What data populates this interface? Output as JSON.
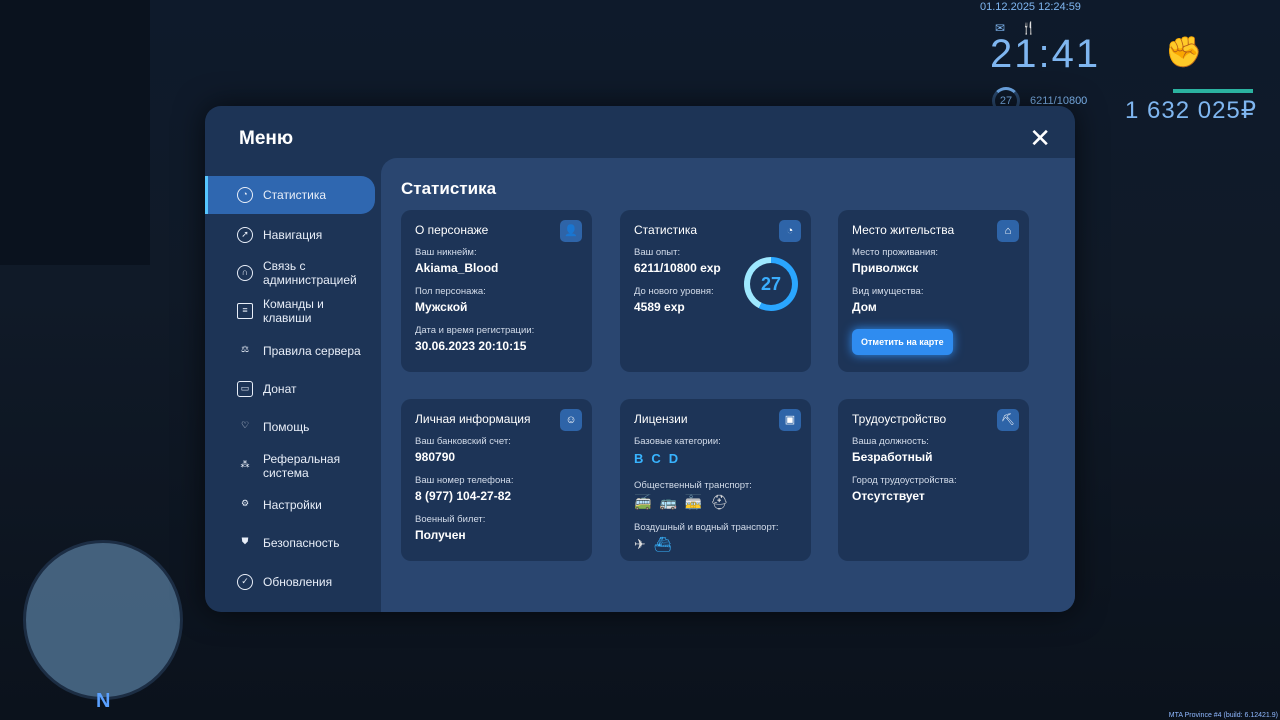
{
  "hud": {
    "date": "01.12.2025 12:24:59",
    "clock": "21:41",
    "level": "27",
    "exp": "6211/10800",
    "money": "1 632 025₽",
    "build": "MTA Province #4 (build: 6.12421.9)",
    "map_north": "N"
  },
  "menu": {
    "title": "Меню",
    "content_title": "Статистика",
    "sidebar": [
      {
        "label": "Статистика",
        "icon": "pie-chart-icon",
        "active": true
      },
      {
        "label": "Навигация",
        "icon": "compass-icon"
      },
      {
        "label": "Связь с администрацией",
        "icon": "headset-icon"
      },
      {
        "label": "Команды и клавиши",
        "icon": "document-icon"
      },
      {
        "label": "Правила сервера",
        "icon": "scales-icon"
      },
      {
        "label": "Донат",
        "icon": "wallet-icon"
      },
      {
        "label": "Помощь",
        "icon": "heart-hands-icon"
      },
      {
        "label": "Реферальная система",
        "icon": "network-icon"
      },
      {
        "label": "Настройки",
        "icon": "gear-icon"
      },
      {
        "label": "Безопасность",
        "icon": "shield-icon"
      },
      {
        "label": "Обновления",
        "icon": "check-circle-icon"
      }
    ]
  },
  "cards": {
    "character": {
      "title": "О персонаже",
      "nick_label": "Ваш никнейм:",
      "nick": "Akiama_Blood",
      "gender_label": "Пол персонажа:",
      "gender": "Мужской",
      "reg_label": "Дата и время регистрации:",
      "reg": "30.06.2023 20:10:15"
    },
    "stats": {
      "title": "Статистика",
      "exp_label": "Ваш опыт:",
      "exp": "6211/10800 exp",
      "next_label": "До нового уровня:",
      "next": "4589 exp",
      "level": "27",
      "progress": 0.575
    },
    "residence": {
      "title": "Место жительства",
      "place_label": "Место проживания:",
      "place": "Приволжск",
      "prop_label": "Вид имущества:",
      "prop": "Дом",
      "button": "Отметить на карте"
    },
    "personal": {
      "title": "Личная информация",
      "bank_label": "Ваш банковский счет:",
      "bank": "980790",
      "phone_label": "Ваш номер телефона:",
      "phone": "8 (977) 104-27-82",
      "military_label": "Военный билет:",
      "military": "Получен"
    },
    "licenses": {
      "title": "Лицензии",
      "basic_label": "Базовые категории:",
      "categories": [
        "B",
        "C",
        "D"
      ],
      "public_label": "Общественный транспорт:",
      "air_label": "Воздушный и водный транспорт:"
    },
    "job": {
      "title": "Трудоустройство",
      "position_label": "Ваша должность:",
      "position": "Безработный",
      "city_label": "Город трудоустройства:",
      "city": "Отсутствует"
    }
  }
}
